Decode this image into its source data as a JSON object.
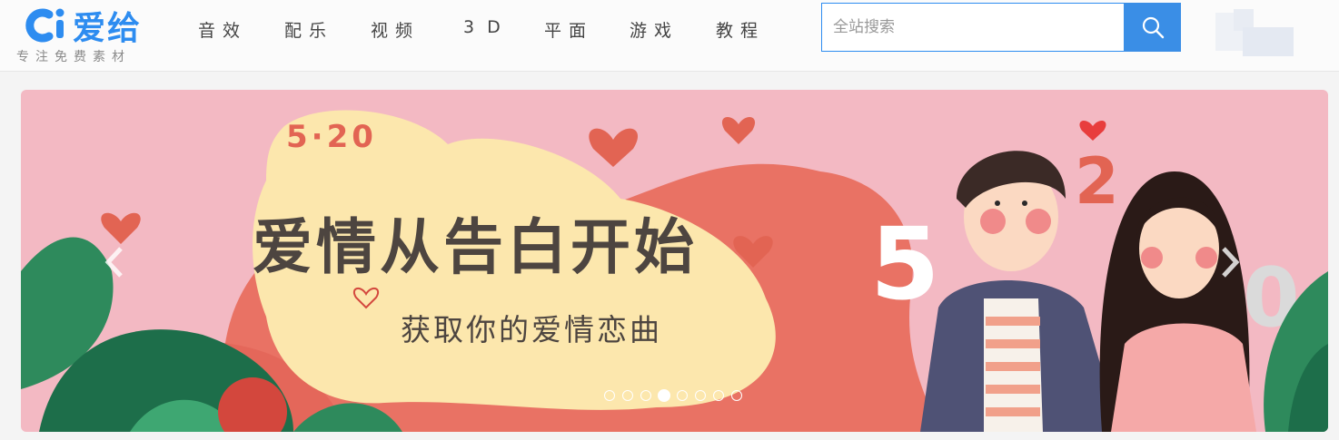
{
  "brand": {
    "name": "爱给",
    "slogan": "专注免费素材"
  },
  "nav": [
    "音效",
    "配乐",
    "视频",
    "3D",
    "平面",
    "游戏",
    "教程"
  ],
  "search": {
    "placeholder": "全站搜索",
    "value": ""
  },
  "banner": {
    "date": "5·20",
    "headline": "爱情从告白开始",
    "subline": "获取你的爱情恋曲",
    "slides_total": 8,
    "active_slide": 4
  },
  "colors": {
    "accent": "#2d8cf0",
    "search_button": "#3a8ee6",
    "banner_bg": "#f3b9c3"
  }
}
